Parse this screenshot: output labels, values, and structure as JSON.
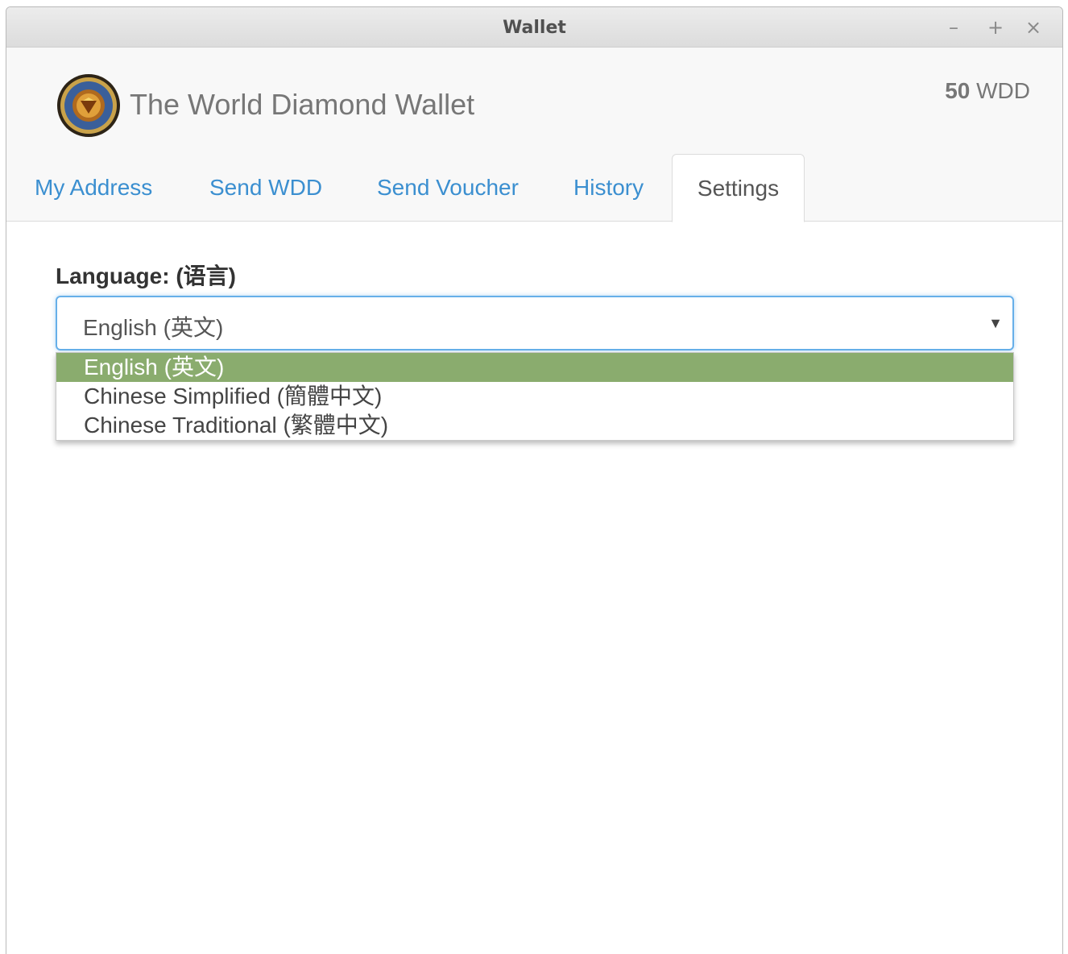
{
  "window": {
    "title": "Wallet",
    "controls": {
      "minimize": "–",
      "maximize": "+",
      "close": "×"
    }
  },
  "header": {
    "brand": "The World Diamond Wallet",
    "balance_amount": "50",
    "balance_unit": "WDD"
  },
  "tabs": [
    {
      "label": "My Address"
    },
    {
      "label": "Send WDD"
    },
    {
      "label": "Send Voucher"
    },
    {
      "label": "History"
    },
    {
      "label": "Settings",
      "active": true
    }
  ],
  "settings": {
    "language_label": "Language: (语言)",
    "language_selected": "English (英文)",
    "language_options": [
      {
        "label": "English (英文)",
        "selected": true
      },
      {
        "label": "Chinese Simplified (簡體中文)"
      },
      {
        "label": "Chinese Traditional (繁體中文)"
      }
    ]
  },
  "colors": {
    "link": "#3b8fd0",
    "option_highlight": "#8aac6e",
    "focus_border": "#66afe9"
  }
}
